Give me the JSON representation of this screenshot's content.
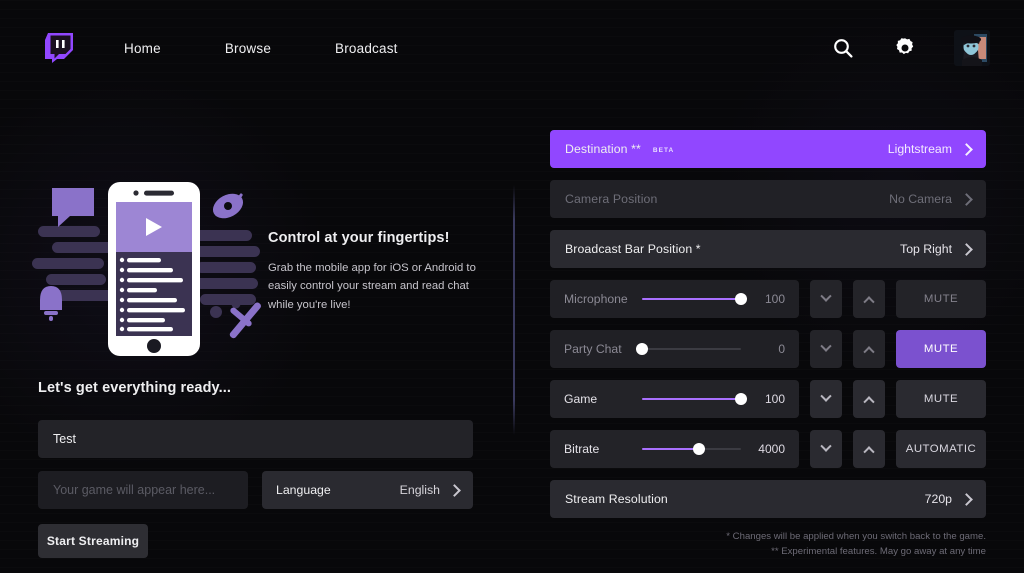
{
  "nav": {
    "logo_icon": "twitch-logo-icon",
    "links": [
      {
        "label": "Home"
      },
      {
        "label": "Browse"
      },
      {
        "label": "Broadcast"
      }
    ],
    "search_icon": "search-icon",
    "settings_icon": "gear-icon",
    "avatar_alt": "user-avatar"
  },
  "promo": {
    "heading": "Control at your fingertips!",
    "body": "Grab the mobile app for iOS or Android to easily control your stream and read chat while you're live!",
    "illustration": "mobile-phone-chat-illustration"
  },
  "setup": {
    "heading": "Let's get everything ready...",
    "title_value": "Test",
    "title_placeholder": "Title",
    "game_value": "",
    "game_placeholder": "Your game will appear here...",
    "language_label": "Language",
    "language_value": "English",
    "start_button": "Start Streaming"
  },
  "settings": {
    "destination": {
      "label": "Destination **",
      "badge": "BETA",
      "value": "Lightstream",
      "accent": "#9147ff"
    },
    "camera_position": {
      "label": "Camera Position",
      "value": "No Camera"
    },
    "broadcast_bar_position": {
      "label": "Broadcast Bar Position *",
      "value": "Top Right"
    },
    "stream_resolution": {
      "label": "Stream Resolution",
      "value": "720p"
    },
    "mixers": [
      {
        "label": "Microphone",
        "value": "100",
        "percent": 100,
        "action": "MUTE",
        "action_state": "off",
        "dim": true
      },
      {
        "label": "Party Chat",
        "value": "0",
        "percent": 0,
        "action": "MUTE",
        "action_state": "on",
        "dim": true
      },
      {
        "label": "Game",
        "value": "100",
        "percent": 100,
        "action": "MUTE",
        "action_state": "normal",
        "dim": false
      },
      {
        "label": "Bitrate",
        "value": "4000",
        "percent": 58,
        "action": "AUTOMATIC",
        "action_state": "normal",
        "dim": false
      }
    ],
    "stepper_down_icon": "chevron-down-icon",
    "stepper_up_icon": "chevron-up-icon"
  },
  "notes": {
    "line1": "* Changes will be applied when you switch back to the game.",
    "line2": "** Experimental features. May go away at any time"
  }
}
